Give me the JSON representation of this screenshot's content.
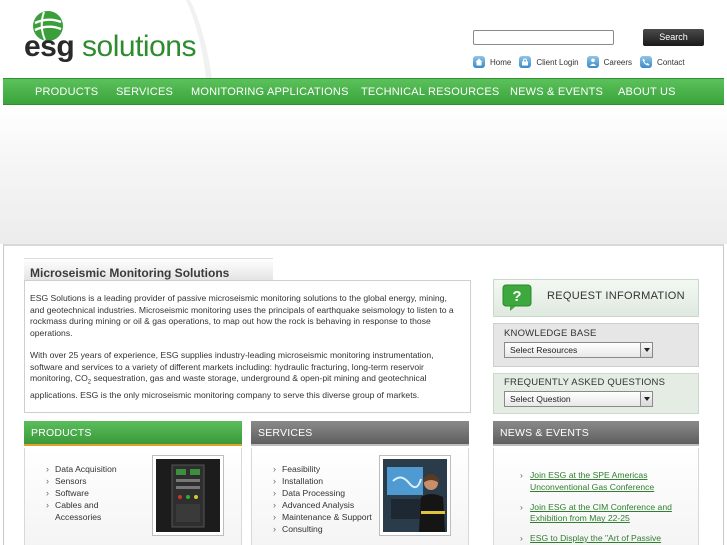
{
  "brand": {
    "logo_text_bold": "esg",
    "logo_text_light": " solutions",
    "green": "#3aa43a",
    "dark": "#2a2a2a"
  },
  "search": {
    "placeholder": "",
    "button_label": "Search"
  },
  "utility_nav": [
    {
      "label": "Home",
      "icon": "home-icon"
    },
    {
      "label": "Client Login",
      "icon": "lock-icon"
    },
    {
      "label": "Careers",
      "icon": "person-icon"
    },
    {
      "label": "Contact",
      "icon": "phone-icon"
    }
  ],
  "main_nav": [
    "PRODUCTS",
    "SERVICES",
    "MONITORING APPLICATIONS",
    "TECHNICAL RESOURCES",
    "NEWS & EVENTS",
    "ABOUT US"
  ],
  "intro": {
    "title": "Microseismic Monitoring Solutions",
    "p1": "ESG Solutions is a leading provider of passive microseismic monitoring solutions to the global energy, mining, and geotechnical industries. Microseismic monitoring uses the principals of earthquake seismology to listen to a rockmass during mining or oil & gas operations, to map out how the rock is behaving in response to those operations.",
    "p2_before_sub": "With over 25 years of experience, ESG supplies industry-leading microseismic monitoring instrumentation, software and services to a variety of different markets including: hydraulic fracturing, long-term reservoir monitoring, CO",
    "p2_sub": "2",
    "p2_after_sub": " sequestration, gas and waste storage, underground & open-pit mining and geotechnical applications. ESG is the only microseismic monitoring company to serve this diverse group of markets."
  },
  "sidebar": {
    "request_info": "REQUEST INFORMATION",
    "knowledge_base": {
      "label": "KNOWLEDGE BASE",
      "select_value": "Select Resources"
    },
    "faq": {
      "label": "FREQUENTLY ASKED QUESTIONS",
      "select_value": "Select Question"
    }
  },
  "panels": {
    "products": {
      "title": "PRODUCTS",
      "items": [
        "Data Acquisition",
        "Sensors",
        "Software",
        "Cables and Accessories"
      ]
    },
    "services": {
      "title": "SERVICES",
      "items": [
        "Feasibility",
        "Installation",
        "Data Processing",
        "Advanced Analysis",
        "Maintenance & Support",
        "Consulting"
      ]
    },
    "news": {
      "title": "NEWS & EVENTS",
      "items": [
        "Join ESG at the SPE Americas Unconventional Gas Conference",
        "Join ESG at the CIM Conference and Exhibition from May 22-25",
        "ESG to Display the \"Art of Passive"
      ]
    }
  }
}
